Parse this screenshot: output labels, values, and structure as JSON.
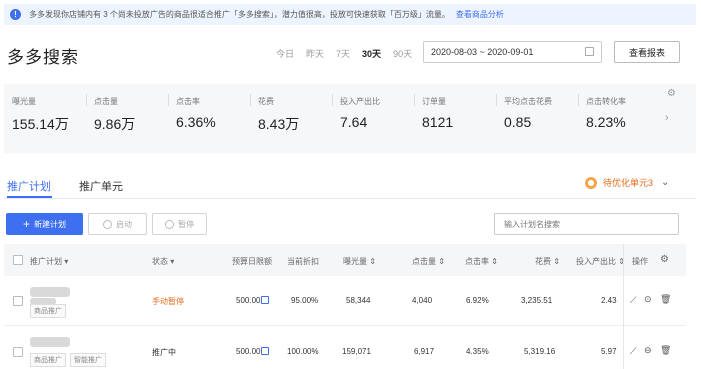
{
  "notice": {
    "icon": "info-icon",
    "text": "多多发现你店铺内有 3 个尚未投放广告的商品很适合推广「多多搜索」，潜力值很高，投放可快速获取「百万级」流量。",
    "link": "查看商品分析"
  },
  "page": {
    "title": "多多搜索"
  },
  "date_ranges": [
    "今日",
    "昨天",
    "7天",
    "30天",
    "90天"
  ],
  "active_range": "30天",
  "date_picker": {
    "value": "2020-08-03 ~ 2020-09-01",
    "icon": "calendar-icon"
  },
  "report_button": "查看报表",
  "metrics": [
    {
      "label": "曝光量",
      "value": "155.14万"
    },
    {
      "label": "点击量",
      "value": "9.86万"
    },
    {
      "label": "点击率",
      "value": "6.36%"
    },
    {
      "label": "花费",
      "value": "8.43万"
    },
    {
      "label": "投入产出比",
      "value": "7.64"
    },
    {
      "label": "订单量",
      "value": "8121"
    },
    {
      "label": "平均点击花费",
      "value": "0.85"
    },
    {
      "label": "点击转化率",
      "value": "8.23%"
    }
  ],
  "tabs": [
    "推广计划",
    "推广单元"
  ],
  "optimize": {
    "label": "待优化单元3",
    "icon": "target-icon"
  },
  "toolbar": {
    "new_plan": "新建计划",
    "start": "启动",
    "pause": "暂停",
    "search_placeholder": "输入计划名搜索"
  },
  "table": {
    "headers": {
      "plan": "推广计划",
      "status": "状态",
      "budget": "预算日限额",
      "discount": "当前折扣",
      "impressions": "曝光量",
      "clicks": "点击量",
      "ctr": "点击率",
      "cost": "花费",
      "roi": "投入产出比",
      "ops": "操作"
    },
    "rows": [
      {
        "tags": [
          "商品推广"
        ],
        "status": "手动暂停",
        "budget": "500.00",
        "discount": "95.00%",
        "impressions": "58,344",
        "clicks": "4,040",
        "ctr": "6.92%",
        "cost": "3,235.51",
        "roi": "2.43",
        "paused": true
      },
      {
        "tags": [
          "商品推广",
          "智能推广"
        ],
        "status": "推广中",
        "budget": "500.00",
        "discount": "100.00%",
        "impressions": "159,071",
        "clicks": "6,917",
        "ctr": "4.35%",
        "cost": "5,319.16",
        "roi": "5.97",
        "paused": false
      }
    ]
  },
  "colors": {
    "accent": "#3d6ff0",
    "warning": "#e86b1c"
  }
}
